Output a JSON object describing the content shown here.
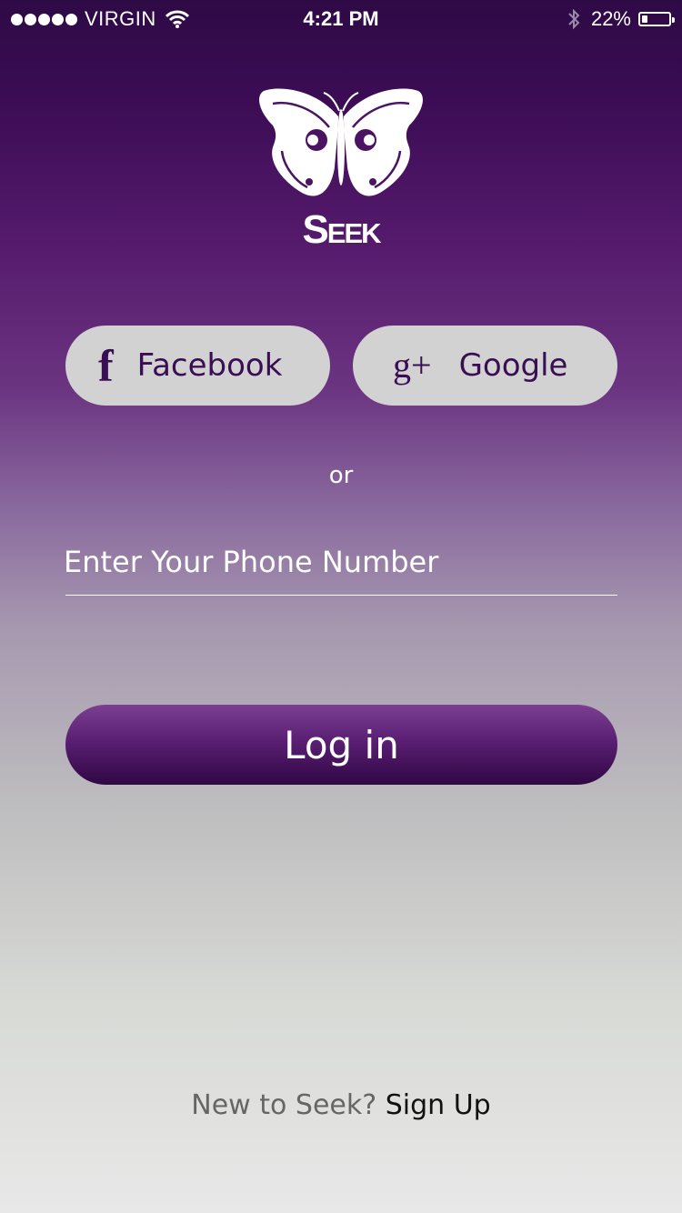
{
  "status_bar": {
    "carrier": "VIRGIN",
    "time": "4:21 PM",
    "battery": "22%",
    "battery_level": 0.22
  },
  "brand": {
    "name": "Seek",
    "logo_icon": "butterfly-icon"
  },
  "social": {
    "facebook_label": "Facebook",
    "facebook_icon": "f",
    "google_label": "Google",
    "google_icon": "g+"
  },
  "separator": "or",
  "phone": {
    "placeholder": "Enter Your Phone Number",
    "value": ""
  },
  "login": {
    "label": "Log in"
  },
  "footer": {
    "prompt": "New to Seek?",
    "link": "Sign Up"
  },
  "colors": {
    "primary": "#4a1463",
    "button_light": "#d2d2d2"
  }
}
